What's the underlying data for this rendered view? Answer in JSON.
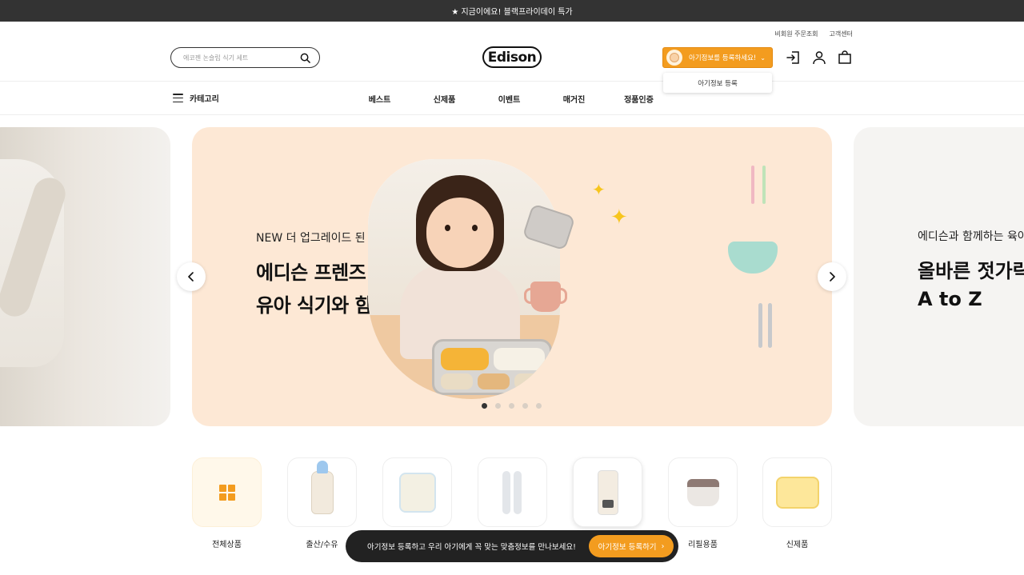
{
  "topbar": {
    "text": "★ 지금이에요! 블랙프라이데이 특가"
  },
  "header": {
    "util_links": [
      "비회원 주문조회",
      "고객센터"
    ],
    "search": {
      "placeholder": "에코젠 논슬립 식기 세트"
    },
    "logo": "Edison",
    "baby_button": {
      "label": "아기정보를 등록하세요!"
    },
    "baby_dropdown": {
      "item": "아기정보 등록"
    },
    "icons": [
      "login-icon",
      "user-icon",
      "cart-icon"
    ]
  },
  "nav": {
    "category_label": "카테고리",
    "items": [
      "베스트",
      "신제품",
      "이벤트",
      "매거진",
      "정품인증"
    ]
  },
  "carousel": {
    "active_index": 0,
    "dot_count": 5,
    "main": {
      "subtitle": "NEW 더 업그레이드 된",
      "title_line1": "에디슨 프렌즈",
      "title_line2": "유아 식기와 함께!"
    },
    "next": {
      "subtitle": "에디슨과 함께하는 육아",
      "title_line1": "올바른 젓가락",
      "title_line2": "A to Z"
    }
  },
  "categories": [
    {
      "label": "전체상품",
      "icon": "grid-icon"
    },
    {
      "label": "출산/수유",
      "icon": "bottle-icon"
    },
    {
      "label": "",
      "icon": "formula-jar-icon"
    },
    {
      "label": "",
      "icon": "spoon-icon"
    },
    {
      "label": "",
      "icon": "thermo-icon"
    },
    {
      "label": "리필용품",
      "icon": "refill-icon"
    },
    {
      "label": "신제품",
      "icon": "new-product-icon"
    }
  ],
  "toast": {
    "message": "아기정보 등록하고 우리 아기에게 꼭 맞는 맞춤정보를 만나보세요!",
    "button_label": "아기정보 등록하기"
  },
  "colors": {
    "accent": "#f39c1f",
    "topbar_bg": "#333333",
    "hero_bg": "#fde8d5"
  }
}
